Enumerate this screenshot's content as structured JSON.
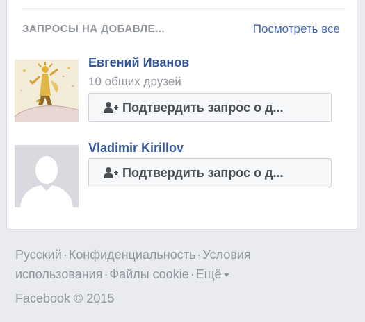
{
  "friend_requests": {
    "title": "ЗАПРОСЫ НА ДОБАВЛЕ...",
    "see_all": "Посмотреть все",
    "items": [
      {
        "name": "Евгений Иванов",
        "mutual_friends": "10 общих друзей",
        "confirm_label": "Подтвердить запрос о д...",
        "avatar": "little-prince-illustration"
      },
      {
        "name": "Vladimir Kirillov",
        "mutual_friends": "",
        "confirm_label": "Подтвердить запрос о д...",
        "avatar": "default-silhouette"
      }
    ]
  },
  "footer": {
    "links": [
      "Русский",
      "Конфиденциальность",
      "Условия использования",
      "Файлы cookie",
      "Ещё"
    ],
    "separator": "·",
    "copyright": "Facebook © 2015"
  },
  "colors": {
    "page_bg": "#e9ebee",
    "card_bg": "#ffffff",
    "link_blue": "#4267b2",
    "name_blue": "#365899",
    "muted_text": "#90949c",
    "button_text": "#4b4f56",
    "button_bg": "#f6f7f9"
  },
  "icons": {
    "add_friend": "add-friend-icon"
  }
}
